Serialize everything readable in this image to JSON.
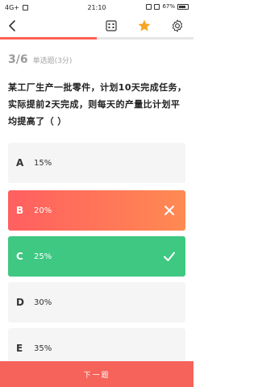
{
  "status_bar": {
    "signal": "4G+",
    "time": "21:10",
    "battery": "67%",
    "battery_level": 0.67
  },
  "header": {
    "back_icon": "chevron-left-icon",
    "grid_icon": "grid-icon",
    "star_icon": "star-icon",
    "settings_icon": "gear-icon",
    "progress": 0.5
  },
  "question": {
    "index": "3/6",
    "type": "单选题(3分)",
    "text": "某工厂生产一批零件，计划10天完成任务，实际提前2天完成，则每天的产量比计划平均提高了（ ）"
  },
  "options": [
    {
      "letter": "A",
      "text": "15%",
      "state": "normal"
    },
    {
      "letter": "B",
      "text": "20%",
      "state": "wrong"
    },
    {
      "letter": "C",
      "text": "25%",
      "state": "correct"
    },
    {
      "letter": "D",
      "text": "30%",
      "state": "normal"
    },
    {
      "letter": "E",
      "text": "35%",
      "state": "normal"
    }
  ],
  "footer": {
    "next_label": "下一题"
  },
  "colors": {
    "accent": "#f5635a",
    "correct": "#3ec882",
    "wrong_start": "#ff5f60",
    "wrong_end": "#ff8a52",
    "star": "#f5a623"
  }
}
